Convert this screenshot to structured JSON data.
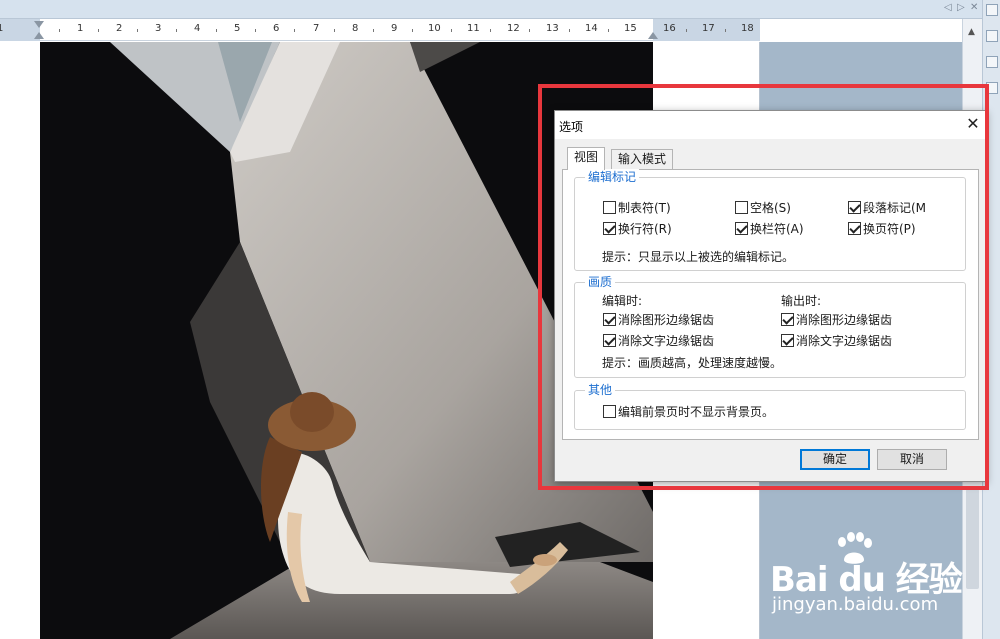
{
  "ruler": {
    "ticks": [
      "1",
      "1",
      "2",
      "3",
      "4",
      "5",
      "6",
      "7",
      "8",
      "9",
      "10",
      "11",
      "12",
      "13",
      "14",
      "15",
      "16",
      "17",
      "18"
    ]
  },
  "dialog": {
    "title": "选项",
    "close_glyph": "✕",
    "tabs": [
      {
        "label": "视图",
        "active": true
      },
      {
        "label": "输入模式",
        "active": false
      }
    ],
    "edit_marks": {
      "title": "编辑标记",
      "items": [
        {
          "label": "制表符(T)",
          "checked": false
        },
        {
          "label": "空格(S)",
          "checked": false
        },
        {
          "label": "段落标记(M",
          "checked": true
        },
        {
          "label": "换行符(R)",
          "checked": true
        },
        {
          "label": "换栏符(A)",
          "checked": true
        },
        {
          "label": "换页符(P)",
          "checked": true
        }
      ],
      "hint": "提示：只显示以上被选的编辑标记。"
    },
    "quality": {
      "title": "画质",
      "edit_label": "编辑时:",
      "output_label": "输出时:",
      "edit_items": [
        {
          "label": "消除图形边缘锯齿",
          "checked": true
        },
        {
          "label": "消除文字边缘锯齿",
          "checked": true
        }
      ],
      "output_items": [
        {
          "label": "消除图形边缘锯齿",
          "checked": true
        },
        {
          "label": "消除文字边缘锯齿",
          "checked": true
        }
      ],
      "hint": "提示：画质越高，处理速度越慢。"
    },
    "other": {
      "title": "其他",
      "items": [
        {
          "label": "编辑前景页时不显示背景页。",
          "checked": false
        }
      ]
    },
    "ok_label": "确定",
    "cancel_label": "取消"
  },
  "watermark": {
    "brand": "Bai du 经验",
    "url": "jingyan.baidu.com"
  },
  "colors": {
    "highlight": "#e8373d",
    "group_title": "#1e6fd0",
    "primary_border": "#0078d7"
  }
}
